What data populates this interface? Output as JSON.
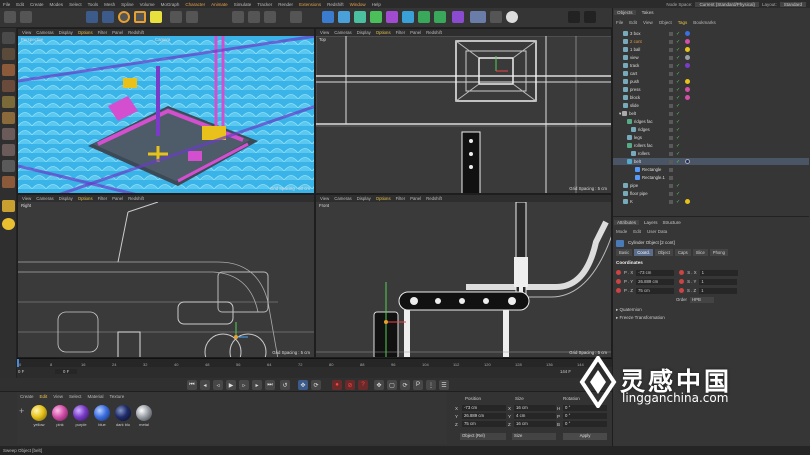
{
  "menu": [
    "File",
    "Edit",
    "Create",
    "Modes",
    "Select",
    "Tools",
    "Mesh",
    "Spline",
    "Volume",
    "MoGraph",
    "Character",
    "Animate",
    "Simulate",
    "Tracker",
    "Render",
    "Extensions",
    "Redshift",
    "Window",
    "Help"
  ],
  "top_right": {
    "node_space_label": "Node Space:",
    "node_space_value": "Current (Standard/Physical)",
    "layout_label": "Layout:",
    "layout_value": "Standard"
  },
  "viewports": {
    "menu": [
      "View",
      "Cameras",
      "Display",
      "Options",
      "Filter",
      "Panel",
      "Redshift"
    ],
    "perspective": {
      "label": "Perspective",
      "camera": "Camera",
      "grid": "Grid Spacing : 50 cm"
    },
    "top": {
      "label": "Top",
      "grid": "Grid Spacing : 5 cm"
    },
    "right": {
      "label": "Right",
      "grid": "Grid Spacing : 5 cm"
    },
    "front": {
      "label": "Front",
      "grid": "Grid Spacing : 5 cm"
    }
  },
  "timeline": {
    "ticks": [
      "0",
      "8",
      "16",
      "24",
      "32",
      "40",
      "48",
      "56",
      "64",
      "72",
      "80",
      "88",
      "96",
      "104",
      "112",
      "120",
      "128",
      "136",
      "144"
    ],
    "frame_left": "0 F",
    "frame_field": "0 F",
    "frame_right": "144 F"
  },
  "materials": {
    "menu": [
      "Create",
      "Edit",
      "View",
      "Select",
      "Material",
      "Texture"
    ],
    "items": [
      {
        "name": "yellow",
        "color": "#e8c21a"
      },
      {
        "name": "pink",
        "color": "#d44fa8"
      },
      {
        "name": "purple",
        "color": "#7a3cc8"
      },
      {
        "name": "blue",
        "color": "#3c6fe0"
      },
      {
        "name": "dark blu",
        "color": "#1f2c6a"
      },
      {
        "name": "metal",
        "color": "#9aa0a6"
      }
    ]
  },
  "coordinates": {
    "headers": [
      "Position",
      "Size",
      "Rotation"
    ],
    "rows": [
      {
        "axis": "X",
        "pos": "-73 cm",
        "size": "16 cm",
        "rot_label": "H",
        "rot": "0 °"
      },
      {
        "axis": "Y",
        "pos": "26.889 cm",
        "size": "4 cm",
        "rot_label": "P",
        "rot": "0 °"
      },
      {
        "axis": "Z",
        "pos": "75 cm",
        "size": "16 cm",
        "rot_label": "B",
        "rot": "0 °"
      }
    ],
    "mode": "Object (Rel)",
    "size_mode": "Size",
    "apply": "Apply"
  },
  "status": "Sweep Object [belt]",
  "objects_panel": {
    "tabs": [
      "Objects",
      "Takes"
    ],
    "menu": [
      "File",
      "Edit",
      "View",
      "Object",
      "Tags",
      "Bookmarks"
    ],
    "items": [
      "3 box",
      "2 cont",
      "1 ball",
      "view",
      "track",
      "cart",
      "push",
      "press",
      "block",
      "slide",
      "belt",
      "ridges fac",
      "ridges",
      "legs",
      "rollers fac",
      "rollers",
      "belt",
      "Rectangle",
      "Rectangle.1",
      "pipe",
      "floor pipe",
      "K"
    ]
  },
  "attributes": {
    "tabs": [
      "Attributes",
      "Layers",
      "Structure"
    ],
    "menu": [
      "Mode",
      "Edit",
      "User Data"
    ],
    "title": "Cylinder Object [2 cont]",
    "subtabs": [
      "Basic",
      "Coord.",
      "Object",
      "Caps",
      "Slice",
      "Phong"
    ],
    "section": "Coordinates",
    "rows": [
      {
        "l1": "P . X",
        "v1": "-73 cm",
        "l2": "S . X",
        "v2": "1"
      },
      {
        "l1": "P . Y",
        "v1": "26.889 cm",
        "l2": "S . Y",
        "v2": "1"
      },
      {
        "l1": "P . Z",
        "v1": "75 cm",
        "l2": "S . Z",
        "v2": "1"
      }
    ],
    "order_label": "Order",
    "order_value": "HPB",
    "sections": [
      "▸ Quaternion",
      "▸ Freeze Transformation"
    ]
  },
  "watermark": {
    "text": "灵感中国",
    "url": "lingganchina.com"
  }
}
